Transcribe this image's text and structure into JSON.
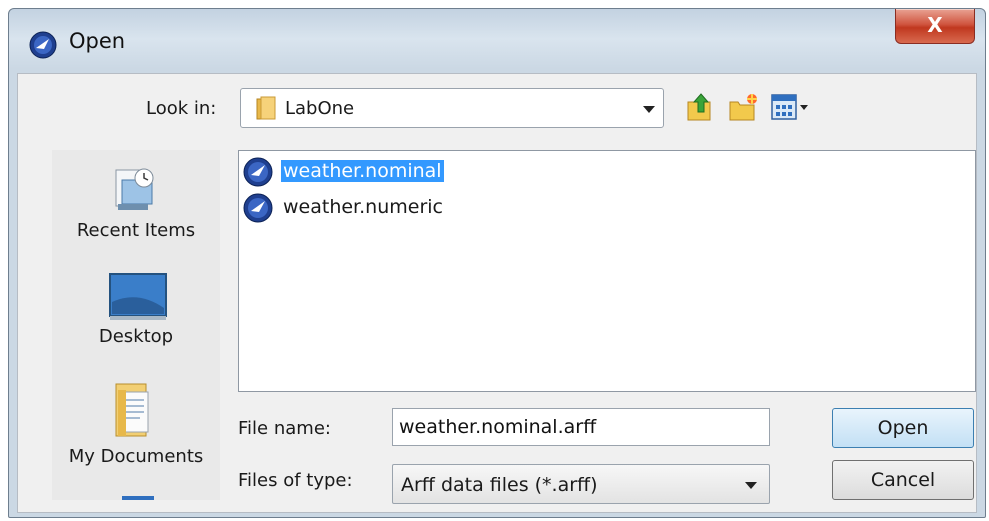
{
  "window": {
    "title": "Open",
    "close_label": "X"
  },
  "toolbar": {
    "lookin_label": "Look in:",
    "lookin_value": "LabOne"
  },
  "places": [
    {
      "label": "Recent Items",
      "icon": "recent-items-icon"
    },
    {
      "label": "Desktop",
      "icon": "desktop-icon"
    },
    {
      "label": "My Documents",
      "icon": "my-documents-icon"
    },
    {
      "label": "",
      "icon": "computer-icon"
    }
  ],
  "files": [
    {
      "name": "weather.nominal",
      "selected": true
    },
    {
      "name": "weather.numeric",
      "selected": false
    }
  ],
  "form": {
    "filename_label": "File name:",
    "filename_value": "weather.nominal.arff",
    "filetype_label": "Files of type:",
    "filetype_value": "Arff data files (*.arff)"
  },
  "buttons": {
    "open_label": "Open",
    "cancel_label": "Cancel"
  },
  "colors": {
    "selection": "#3399ff",
    "close_button": "#c0381f",
    "title_bar": "#c3d2e1"
  }
}
